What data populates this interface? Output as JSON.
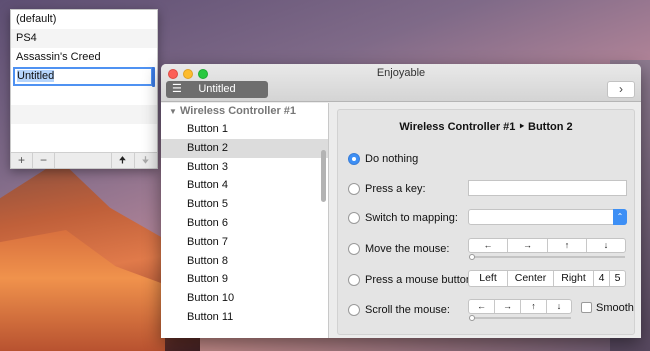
{
  "mappings_panel": {
    "items": [
      "(default)",
      "PS4",
      "Assassin's Creed",
      "Untitled"
    ],
    "add_label": "+",
    "remove_label": "−",
    "move_up_label": "🠉",
    "move_down_label": "🠋"
  },
  "window": {
    "title": "Enjoyable",
    "mapping_button_label": "Untitled",
    "list_icon": "list-icon",
    "nav_label": "›"
  },
  "sidebar": {
    "group_label": "Wireless Controller #1",
    "buttons": [
      "Button 1",
      "Button 2",
      "Button 3",
      "Button 4",
      "Button 5",
      "Button 6",
      "Button 7",
      "Button 8",
      "Button 9",
      "Button 10",
      "Button 11"
    ],
    "selected": "Button 2"
  },
  "panel": {
    "title": "Wireless Controller #1 ‣ Button 2",
    "options": {
      "do_nothing": "Do nothing",
      "press_key": "Press a key:",
      "switch_mapping": "Switch to mapping:",
      "move_mouse": "Move the mouse:",
      "press_mouse_button": "Press a mouse button:",
      "scroll_mouse": "Scroll the mouse:"
    },
    "selected_option": "Do nothing",
    "mouse_dirs": [
      "←",
      "→",
      "↑",
      "↓"
    ],
    "mouse_buttons": [
      "Left",
      "Center",
      "Right",
      "4",
      "5"
    ],
    "smooth_label": "Smooth"
  },
  "colors": {
    "accent": "#3d8ff5",
    "selection_border": "#4f92f2",
    "selected_row": "#dcdcdc"
  }
}
